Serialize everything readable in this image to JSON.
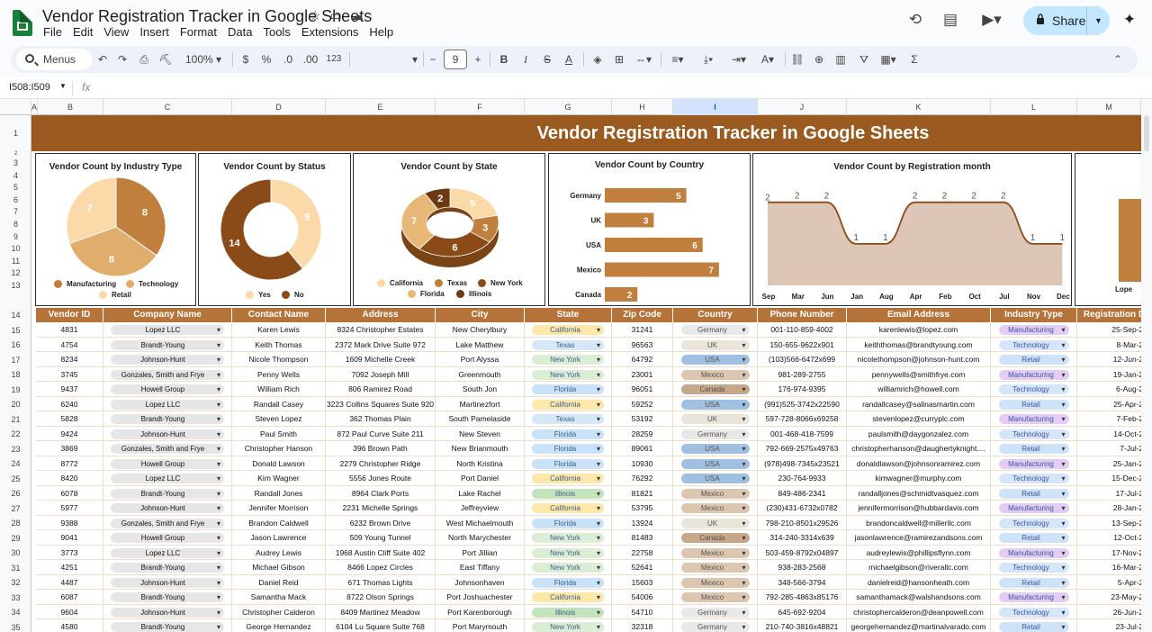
{
  "doc_title": "Vendor Registration Tracker in Google Sheets",
  "menu": [
    "File",
    "Edit",
    "View",
    "Insert",
    "Format",
    "Data",
    "Tools",
    "Extensions",
    "Help"
  ],
  "share_label": "Share",
  "toolbar": {
    "search": "Menus",
    "zoom": "100%",
    "currency": "$",
    "percent": "%",
    "dec_dec": ".0",
    "inc_dec": ".00",
    "number_format": "123",
    "font_size": "9"
  },
  "name_box": "I508:I509",
  "fx": "fx",
  "column_letters": [
    "A",
    "B",
    "C",
    "D",
    "E",
    "F",
    "G",
    "H",
    "I",
    "J",
    "K",
    "L",
    "M"
  ],
  "row_numbers": [
    "1",
    "2",
    "3",
    "4",
    "5",
    "6",
    "7",
    "8",
    "9",
    "10",
    "11",
    "12",
    "13",
    "14",
    "15",
    "16",
    "17",
    "18",
    "19",
    "20",
    "21",
    "22",
    "23",
    "24",
    "25",
    "26",
    "27",
    "28",
    "29",
    "30",
    "31",
    "32",
    "33",
    "34",
    "35"
  ],
  "banner_title": "Vendor Registration Tracker in Google Sheets",
  "charts": {
    "industry": {
      "title": "Vendor Count by Industry Type",
      "legend": [
        "Manufacturing",
        "Technology",
        "Retail"
      ]
    },
    "status": {
      "title": "Vendor Count by Status",
      "legend": [
        "Yes",
        "No"
      ]
    },
    "state": {
      "title": "Vendor Count by State",
      "legend": [
        "California",
        "Texas",
        "New York",
        "Florida",
        "Illinois"
      ]
    },
    "country": {
      "title": "Vendor Count by Country"
    },
    "month": {
      "title": "Vendor Count by Registration month"
    },
    "partial_label": "Lope"
  },
  "chart_data": [
    {
      "type": "pie",
      "title": "Vendor Count by Industry Type",
      "categories": [
        "Manufacturing",
        "Technology",
        "Retail"
      ],
      "values": [
        8,
        8,
        7
      ],
      "colors": [
        "#c17f3e",
        "#e1ad6c",
        "#fcd9a8"
      ]
    },
    {
      "type": "pie",
      "title": "Vendor Count by Status",
      "categories": [
        "Yes",
        "No"
      ],
      "values": [
        9,
        14
      ],
      "colors": [
        "#fcd9a8",
        "#8a4b18"
      ]
    },
    {
      "type": "pie",
      "title": "Vendor Count by State",
      "categories": [
        "California",
        "Texas",
        "New York",
        "Florida",
        "Illinois"
      ],
      "values": [
        5,
        3,
        6,
        7,
        2
      ],
      "colors": [
        "#fcd9a8",
        "#c17f3e",
        "#8a4b18",
        "#e8b878",
        "#6b3a12"
      ]
    },
    {
      "type": "bar",
      "title": "Vendor Count by Country",
      "categories": [
        "Germany",
        "UK",
        "USA",
        "Mexico",
        "Canada"
      ],
      "values": [
        5,
        3,
        6,
        7,
        2
      ],
      "xlim": [
        0,
        8
      ]
    },
    {
      "type": "area",
      "title": "Vendor Count by Registration month",
      "categories": [
        "Sep",
        "Mar",
        "Jun",
        "Jan",
        "Aug",
        "Apr",
        "Feb",
        "Oct",
        "Jul",
        "Nov",
        "Dec"
      ],
      "values": [
        2,
        2,
        2,
        1,
        1,
        2,
        2,
        2,
        2,
        1,
        1
      ],
      "ylim": [
        0,
        2.6
      ]
    }
  ],
  "table": {
    "headers": [
      "Vendor ID",
      "Company Name",
      "Contact Name",
      "Address",
      "City",
      "State",
      "Zip Code",
      "Country",
      "Phone Number",
      "Email Address",
      "Industry Type",
      "Registration D"
    ],
    "rows": [
      [
        "4831",
        "Lopez LLC",
        "Karen Lewis",
        "8324 Christopher Estates",
        "New Cherylbury",
        "California",
        "31241",
        "Germany",
        "001-110-859-4002",
        "karenlewis@lopez.com",
        "Manufacturing",
        "25-Sep-24"
      ],
      [
        "4754",
        "Brandt-Young",
        "Keith Thomas",
        "2372 Mark Drive Suite 972",
        "Lake Matthew",
        "Texas",
        "96563",
        "UK",
        "150-655-9622x901",
        "keiththomas@brandtyoung.com",
        "Technology",
        "8-Mar-24"
      ],
      [
        "8234",
        "Johnson-Hunt",
        "Nicole Thompson",
        "1609 Michelle Creek",
        "Port Alyssa",
        "New York",
        "64792",
        "USA",
        "(103)566-6472x699",
        "nicolethompson@johnson-hunt.com",
        "Retail",
        "12-Jun-24"
      ],
      [
        "3745",
        "Gonzales, Smith and Frye",
        "Penny Wells",
        "7092 Joseph Mill",
        "Greenmouth",
        "New York",
        "23001",
        "Mexico",
        "981-289-2755",
        "pennywells@smithfrye.com",
        "Manufacturing",
        "19-Jan-24"
      ],
      [
        "9437",
        "Howell Group",
        "William Rich",
        "806 Ramirez Road",
        "South Jon",
        "Florida",
        "96051",
        "Canada",
        "176-974-9395",
        "williamrich@howell.com",
        "Technology",
        "6-Aug-24"
      ],
      [
        "6240",
        "Lopez LLC",
        "Randall Casey",
        "3223 Collins Squares Suite 920",
        "Martinezfort",
        "California",
        "59252",
        "USA",
        "(991)525-3742x22590",
        "randallcasey@salinasmartin.com",
        "Retail",
        "25-Apr-24"
      ],
      [
        "5828",
        "Brandt-Young",
        "Steven Lopez",
        "362 Thomas Plain",
        "South Pamelaside",
        "Texas",
        "53192",
        "UK",
        "597-728-8066x69258",
        "stevenlopez@curryplc.com",
        "Manufacturing",
        "7-Feb-24"
      ],
      [
        "9424",
        "Johnson-Hunt",
        "Paul Smith",
        "872 Paul Curve Suite 211",
        "New Steven",
        "Florida",
        "28259",
        "Germany",
        "001-468-418-7599",
        "paulsmith@daygonzalez.com",
        "Technology",
        "14-Oct-24"
      ],
      [
        "3869",
        "Gonzales, Smith and Frye",
        "Christopher Hanson",
        "396 Brown Path",
        "New Brianmouth",
        "Florida",
        "89061",
        "USA",
        "792-669-2575x49763",
        "christopherhanson@daughertyknight....",
        "Retail",
        "7-Jul-24"
      ],
      [
        "8772",
        "Howell Group",
        "Donald Lawson",
        "2279 Christopher Ridge",
        "North Kristina",
        "Florida",
        "10930",
        "USA",
        "(978)498-7345x23521",
        "donaldlawson@johnsonramirez.com",
        "Manufacturing",
        "25-Jan-24"
      ],
      [
        "8420",
        "Lopez LLC",
        "Kim Wagner",
        "5556 Jones Route",
        "Port Daniel",
        "California",
        "76292",
        "USA",
        "230-764-9933",
        "kimwagner@murphy.com",
        "Technology",
        "15-Dec-24"
      ],
      [
        "6078",
        "Brandt-Young",
        "Randall Jones",
        "8964 Clark Ports",
        "Lake Rachel",
        "Illinois",
        "81821",
        "Mexico",
        "849-486-2341",
        "randalljones@schmidtvasquez.com",
        "Retail",
        "17-Jul-24"
      ],
      [
        "5977",
        "Johnson-Hunt",
        "Jennifer Morrison",
        "2231 Michelle Springs",
        "Jeffreyview",
        "California",
        "53795",
        "Mexico",
        "(230)431-6732x0782",
        "jennifermorrison@hubbardavis.com",
        "Manufacturing",
        "28-Jan-24"
      ],
      [
        "9388",
        "Gonzales, Smith and Frye",
        "Brandon Caldwell",
        "6232 Brown Drive",
        "West Michaelmouth",
        "Florida",
        "13924",
        "UK",
        "798-210-8501x29526",
        "brandoncaldwell@millerllc.com",
        "Technology",
        "13-Sep-24"
      ],
      [
        "9041",
        "Howell Group",
        "Jason Lawrence",
        "509 Young Tunnel",
        "North Marychester",
        "New York",
        "81483",
        "Canada",
        "314-240-3314x639",
        "jasonlawrence@ramirezandsons.com",
        "Retail",
        "12-Oct-24"
      ],
      [
        "3773",
        "Lopez LLC",
        "Audrey Lewis",
        "1968 Austin Cliff Suite 402",
        "Port Jillian",
        "New York",
        "22758",
        "Mexico",
        "503-459-8792x04897",
        "audreylewis@phillipsflynn.com",
        "Manufacturing",
        "17-Nov-24"
      ],
      [
        "4251",
        "Brandt-Young",
        "Michael Gibson",
        "8466 Lopez Circles",
        "East Tiffany",
        "New York",
        "52641",
        "Mexico",
        "938-283-2568",
        "michaelgibson@riverallc.com",
        "Technology",
        "16-Mar-24"
      ],
      [
        "4487",
        "Johnson-Hunt",
        "Daniel Reid",
        "671 Thomas Lights",
        "Johnsonhaven",
        "Florida",
        "15603",
        "Mexico",
        "348-566-3794",
        "danielreid@hansonheath.com",
        "Retail",
        "5-Apr-24"
      ],
      [
        "6087",
        "Brandt-Young",
        "Samantha Mack",
        "8722 Olson Springs",
        "Port Joshuachester",
        "California",
        "54006",
        "Mexico",
        "792-285-4863x85176",
        "samanthamack@walshandsons.com",
        "Manufacturing",
        "23-May-24"
      ],
      [
        "9604",
        "Johnson-Hunt",
        "Christopher Calderon",
        "8409 Martinez Meadow",
        "Port Karenborough",
        "Illinois",
        "54710",
        "Germany",
        "645-692-9204",
        "christophercalderon@deanpowell.com",
        "Technology",
        "26-Jun-24"
      ],
      [
        "4580",
        "Brandt-Young",
        "George Hernandez",
        "6104 Lu Square Suite 768",
        "Port Marymouth",
        "New York",
        "32318",
        "Germany",
        "210-740-3816x48821",
        "georgehernandez@martinalvarado.com",
        "Retail",
        "23-Jul-24"
      ]
    ]
  },
  "chip_colors": {
    "California": "#fde7a9",
    "Texas": "#d6e7f7",
    "New York": "#dbedd5",
    "Florida": "#c9e2f8",
    "Illinois": "#c3e3bd",
    "Germany": "#e8e8e8",
    "UK": "#e9e5da",
    "USA": "#9fc0e0",
    "Mexico": "#dcc6b0",
    "Canada": "#c7a78a",
    "Manufacturing": "#e3cdf5",
    "Technology": "#d6e6fa",
    "Retail": "#cfe3f8",
    "company": "#e6e6e6"
  }
}
